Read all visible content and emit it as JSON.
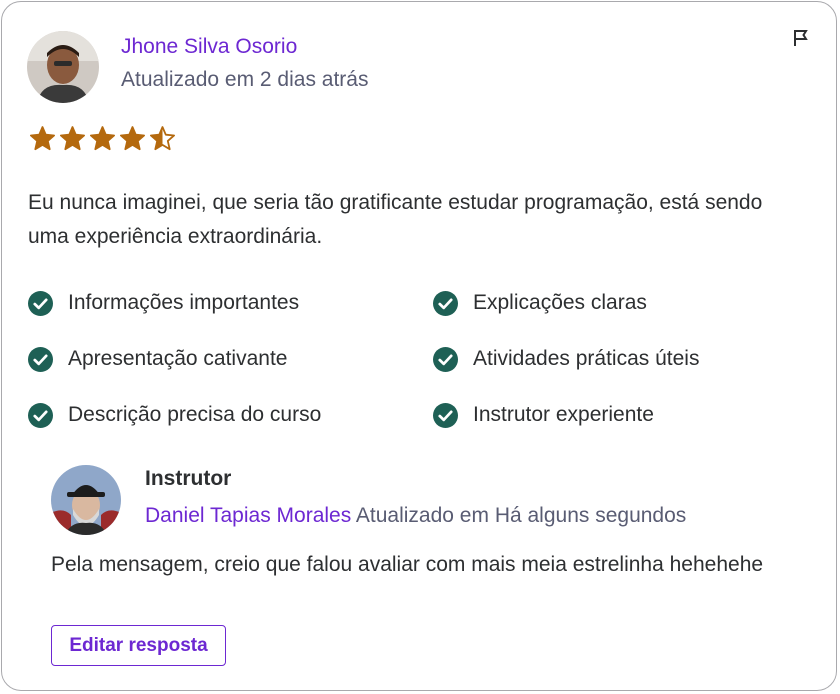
{
  "review": {
    "reviewer_name": "Jhone Silva Osorio",
    "updated": "Atualizado em 2 dias atrás",
    "rating": 4.5,
    "rating_max": 5,
    "star_color": "#b4690e",
    "text": "Eu nunca imaginei, que seria tão gratificante estudar programação, está sendo uma experiência extraordinária.",
    "tags": [
      "Informações importantes",
      "Explicações claras",
      "Apresentação cativante",
      "Atividades práticas úteis",
      "Descrição precisa do curso",
      "Instrutor experiente"
    ]
  },
  "reply": {
    "heading": "Instrutor",
    "instructor_name": "Daniel Tapias Morales",
    "updated": "Atualizado em Há alguns segundos",
    "text": "Pela mensagem, creio que falou avaliar com mais meia estrelinha hehehehe",
    "edit_label": "Editar resposta"
  },
  "colors": {
    "accent": "#6d28d2",
    "check": "#1e6055",
    "muted_text": "#595c73"
  },
  "icons": {
    "flag": "flag-icon",
    "check": "check-circle-icon",
    "star": "star-icon"
  }
}
